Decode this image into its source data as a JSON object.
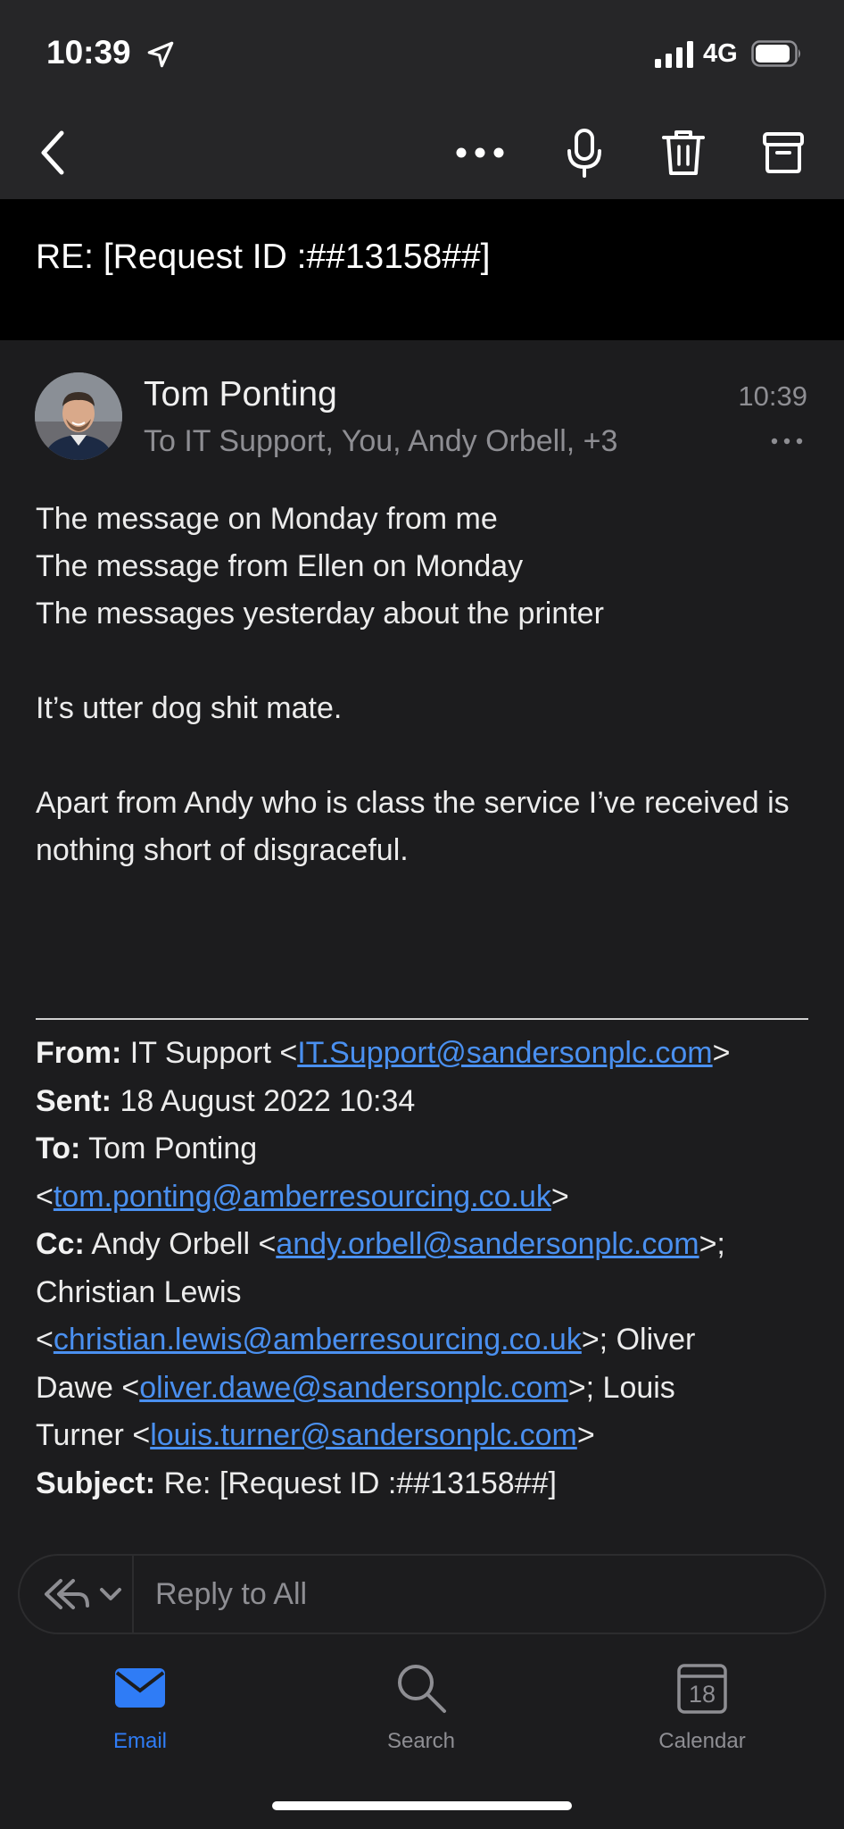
{
  "status": {
    "time": "10:39",
    "network": "4G"
  },
  "toolbar": {
    "back_icon": "chevron-left-icon",
    "more_icon": "ellipsis-icon",
    "mic_icon": "microphone-icon",
    "delete_icon": "trash-icon",
    "archive_icon": "archive-icon"
  },
  "email": {
    "subject": "RE: [Request ID :##13158##]",
    "sender": "Tom Ponting",
    "recipients": "To IT Support, You, Andy Orbell, +3",
    "time": "10:39",
    "body": [
      "The message on Monday from me",
      "The message from Ellen on Monday",
      "The messages yesterday about the printer",
      "",
      "It’s utter dog shit mate.",
      "",
      "Apart from Andy who is class the service I’ve received is nothing short of disgraceful."
    ],
    "quoted": {
      "from_label": "From:",
      "from_name": " IT Support <",
      "from_email": "IT.Support@sandersonplc.com",
      "from_end": ">",
      "sent_label": "Sent:",
      "sent_value": " 18 August 2022 10:34",
      "to_label": "To:",
      "to_name": " Tom Ponting",
      "to_open": "<",
      "to_email": "tom.ponting@amberresourcing.co.uk",
      "to_end": ">",
      "cc_label": "Cc:",
      "cc_name1": " Andy Orbell <",
      "cc_email1": "andy.orbell@sandersonplc.com",
      "cc_sep1": ">;",
      "cc_name2": "Christian Lewis",
      "cc_open2": "<",
      "cc_email2": "christian.lewis@amberresourcing.co.uk",
      "cc_sep2": ">; Oliver",
      "cc_name3": "Dawe <",
      "cc_email3": "oliver.dawe@sandersonplc.com",
      "cc_sep3": ">; Louis",
      "cc_name4": "Turner <",
      "cc_email4": "louis.turner@sandersonplc.com",
      "cc_end": ">",
      "subject_label": "Subject:",
      "subject_value": " Re: [Request ID :##13158##]"
    }
  },
  "reply": {
    "placeholder": "Reply to All"
  },
  "tabs": {
    "email": "Email",
    "search": "Search",
    "calendar": "Calendar",
    "calendar_day": "18"
  },
  "colors": {
    "accent": "#2f7cf6",
    "link": "#4a90f0",
    "background": "#1c1c1e"
  }
}
